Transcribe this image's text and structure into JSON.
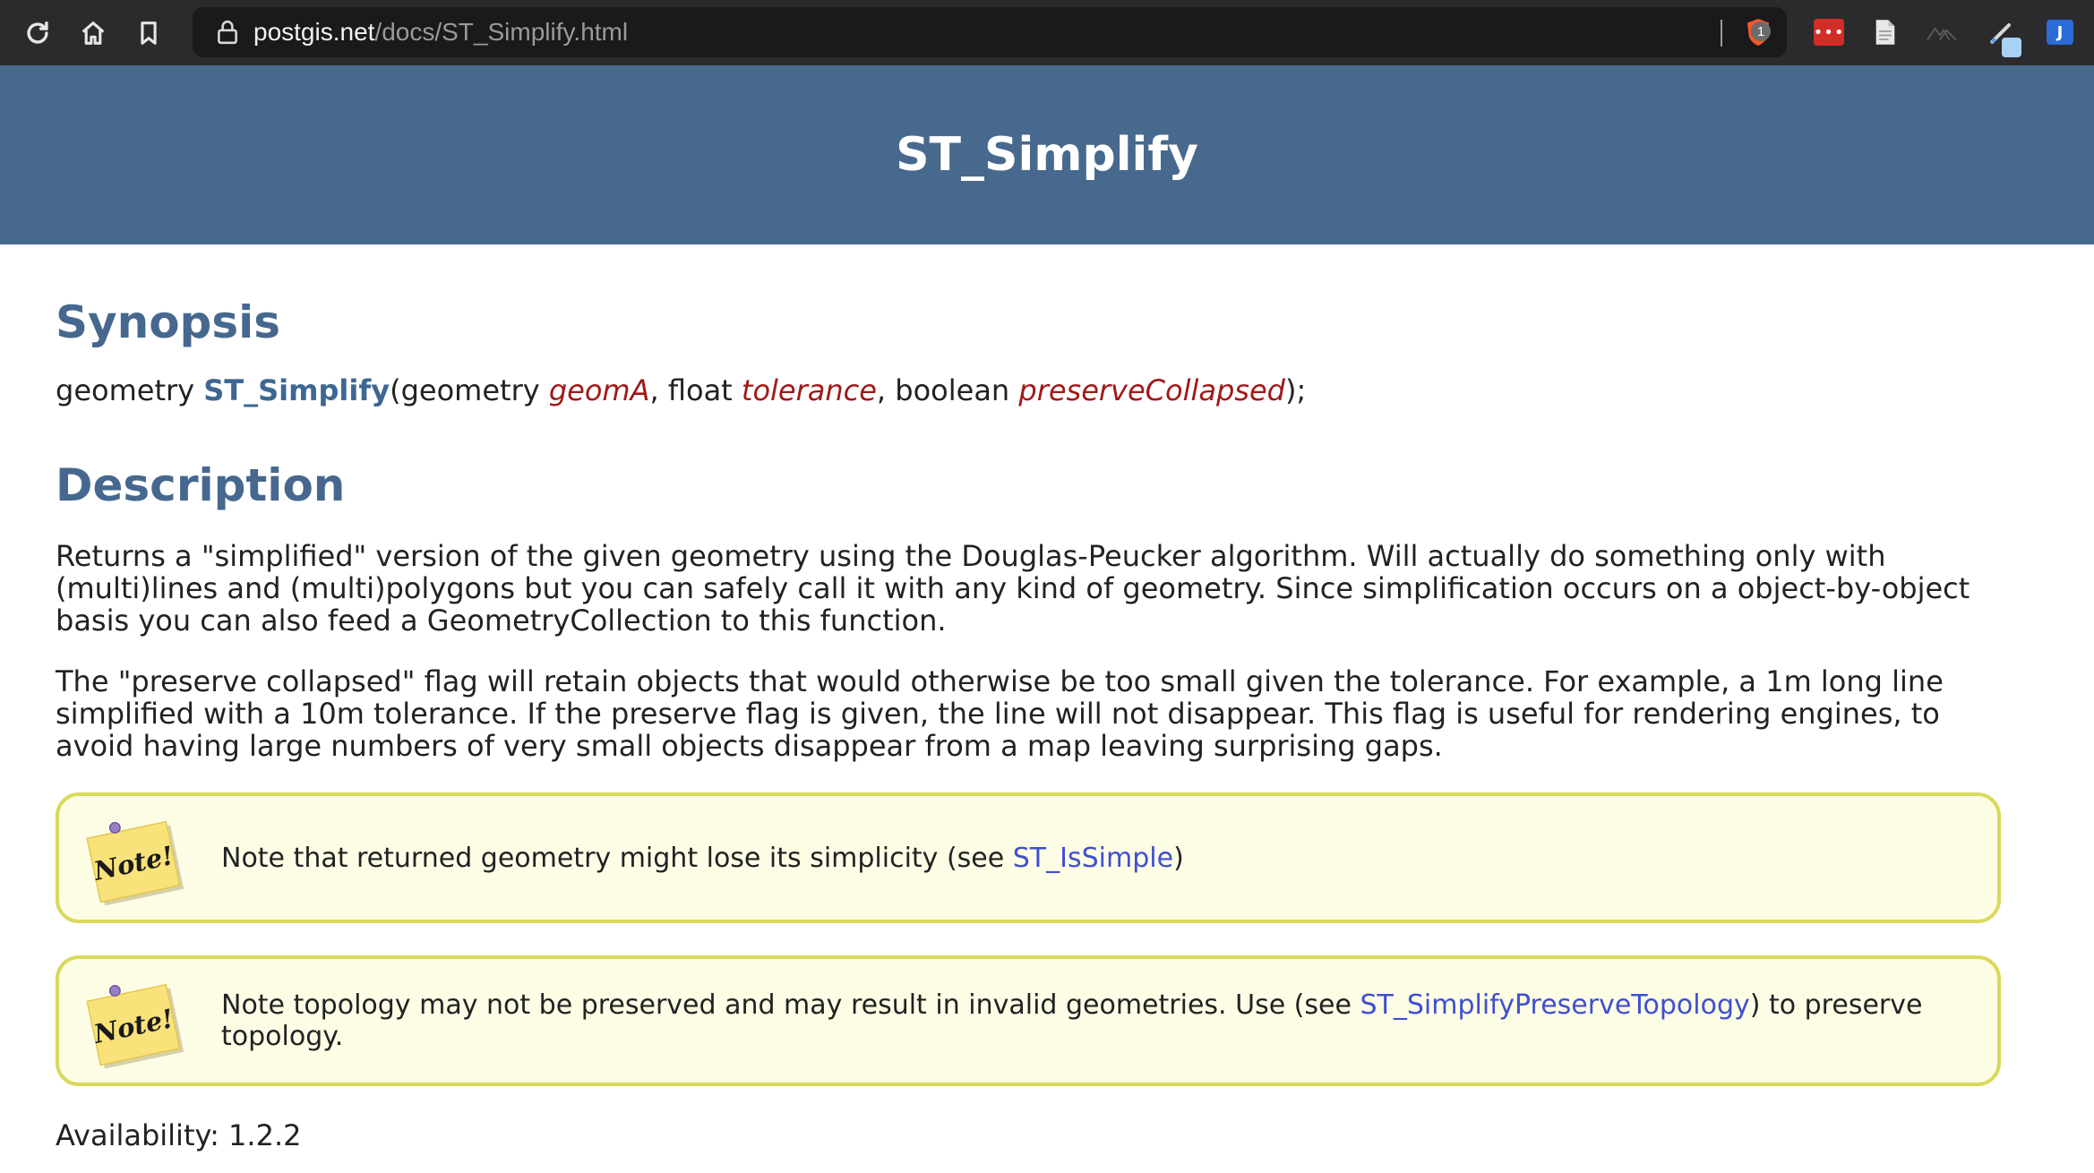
{
  "browser": {
    "url_host": "postgis.net",
    "url_path": "/docs/ST_Simplify.html",
    "shield_count": "1",
    "ext_lastpass_label": "•••",
    "ext_tag_label": "J"
  },
  "page": {
    "title": "ST_Simplify"
  },
  "synopsis": {
    "heading": "Synopsis",
    "return_type": "geometry ",
    "function_name": "ST_Simplify",
    "open_paren": "(",
    "arg1_type": "geometry ",
    "arg1_name": "geomA",
    "sep1": ", ",
    "arg2_type": "float ",
    "arg2_name": "tolerance",
    "sep2": ", ",
    "arg3_type": "boolean ",
    "arg3_name": "preserveCollapsed",
    "close": ");"
  },
  "description": {
    "heading": "Description",
    "paragraph1": "Returns a \"simplified\" version of the given geometry using the Douglas-Peucker algorithm. Will actually do something only with (multi)lines and (multi)polygons but you can safely call it with any kind of geometry. Since simplification occurs on a object-by-object basis you can also feed a GeometryCollection to this function.",
    "paragraph2": "The \"preserve collapsed\" flag will retain objects that would otherwise be too small given the tolerance. For example, a 1m long line simplified with a 10m tolerance. If the preserve flag is given, the line will not disappear. This flag is useful for rendering engines, to avoid having large numbers of very small objects disappear from a map leaving surprising gaps."
  },
  "notes": [
    {
      "icon_label": "Note!",
      "text_before": "Note that returned geometry might lose its simplicity (see ",
      "link": "ST_IsSimple",
      "text_after": ")"
    },
    {
      "icon_label": "Note!",
      "text_before": "Note topology may not be preserved and may result in invalid geometries. Use (see ",
      "link": "ST_SimplifyPreserveTopology",
      "text_after": ") to preserve topology."
    }
  ],
  "availability": "Availability: 1.2.2",
  "colors": {
    "header_bg": "#48698e",
    "heading": "#46688f",
    "param": "#a01919",
    "link": "#3f4fd0",
    "note_border": "#d9d95c",
    "note_bg": "#fdfde6"
  }
}
